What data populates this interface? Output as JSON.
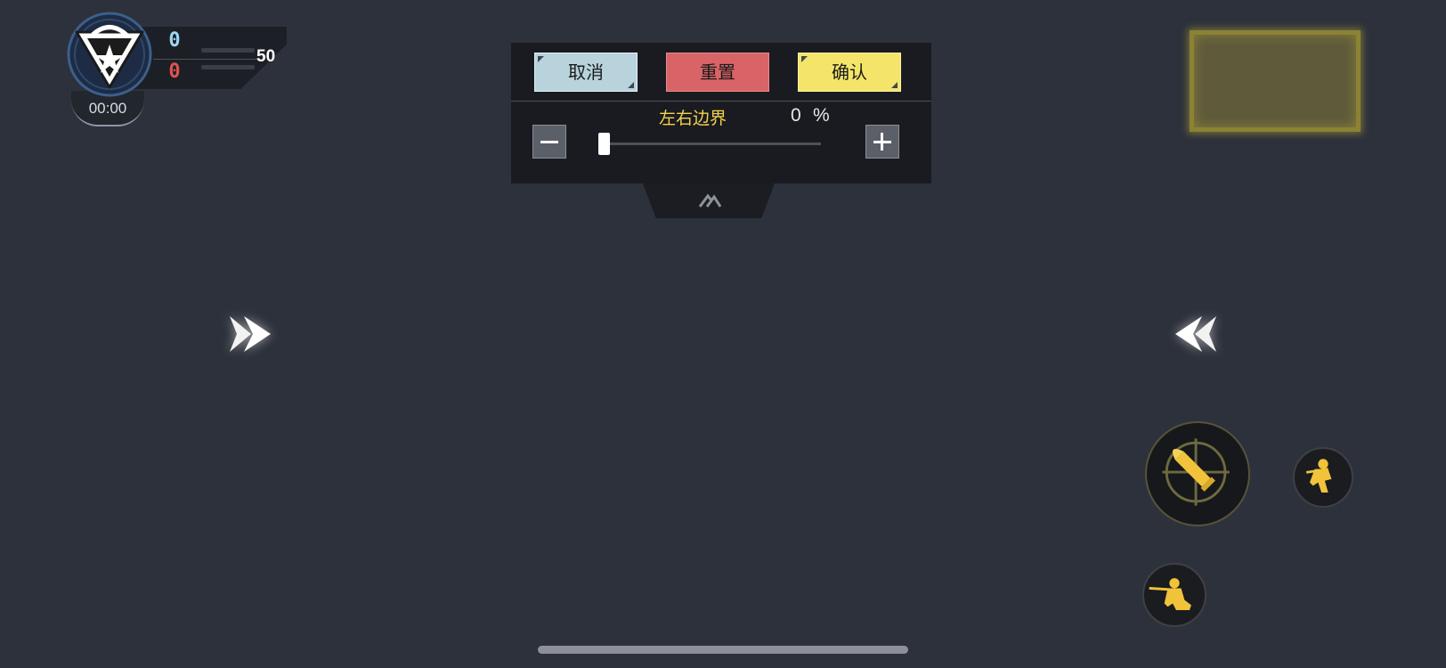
{
  "scoreboard": {
    "blue_score": "0",
    "red_score": "0",
    "target_score": "50",
    "timer": "00:00",
    "emblem_icon": "faction-emblem-icon"
  },
  "settings_panel": {
    "cancel_label": "取消",
    "reset_label": "重置",
    "confirm_label": "确认",
    "slider_label": "左右边界",
    "slider_value": "0",
    "slider_unit": "%",
    "slider_fraction": 0,
    "minus_icon": "minus-icon",
    "plus_icon": "plus-icon",
    "collapse_icon": "double-chevron-up-icon"
  },
  "colors": {
    "background": "#2d313b",
    "panel": "#191b20",
    "cancel": "#b8d3dc",
    "reset": "#d86467",
    "confirm": "#f4e56a",
    "accent_yellow": "#f2d24b",
    "blue_team": "#9fd6f0",
    "red_team": "#e0524f"
  },
  "hud": {
    "minimap_icon": "minimap-placeholder",
    "left_arrow_icon": "double-chevron-right-icon",
    "right_arrow_icon": "double-chevron-left-icon",
    "fire_icon": "bullet-crosshair-icon",
    "crouch_icon": "crouch-soldier-icon",
    "prone_icon": "prone-soldier-icon"
  }
}
